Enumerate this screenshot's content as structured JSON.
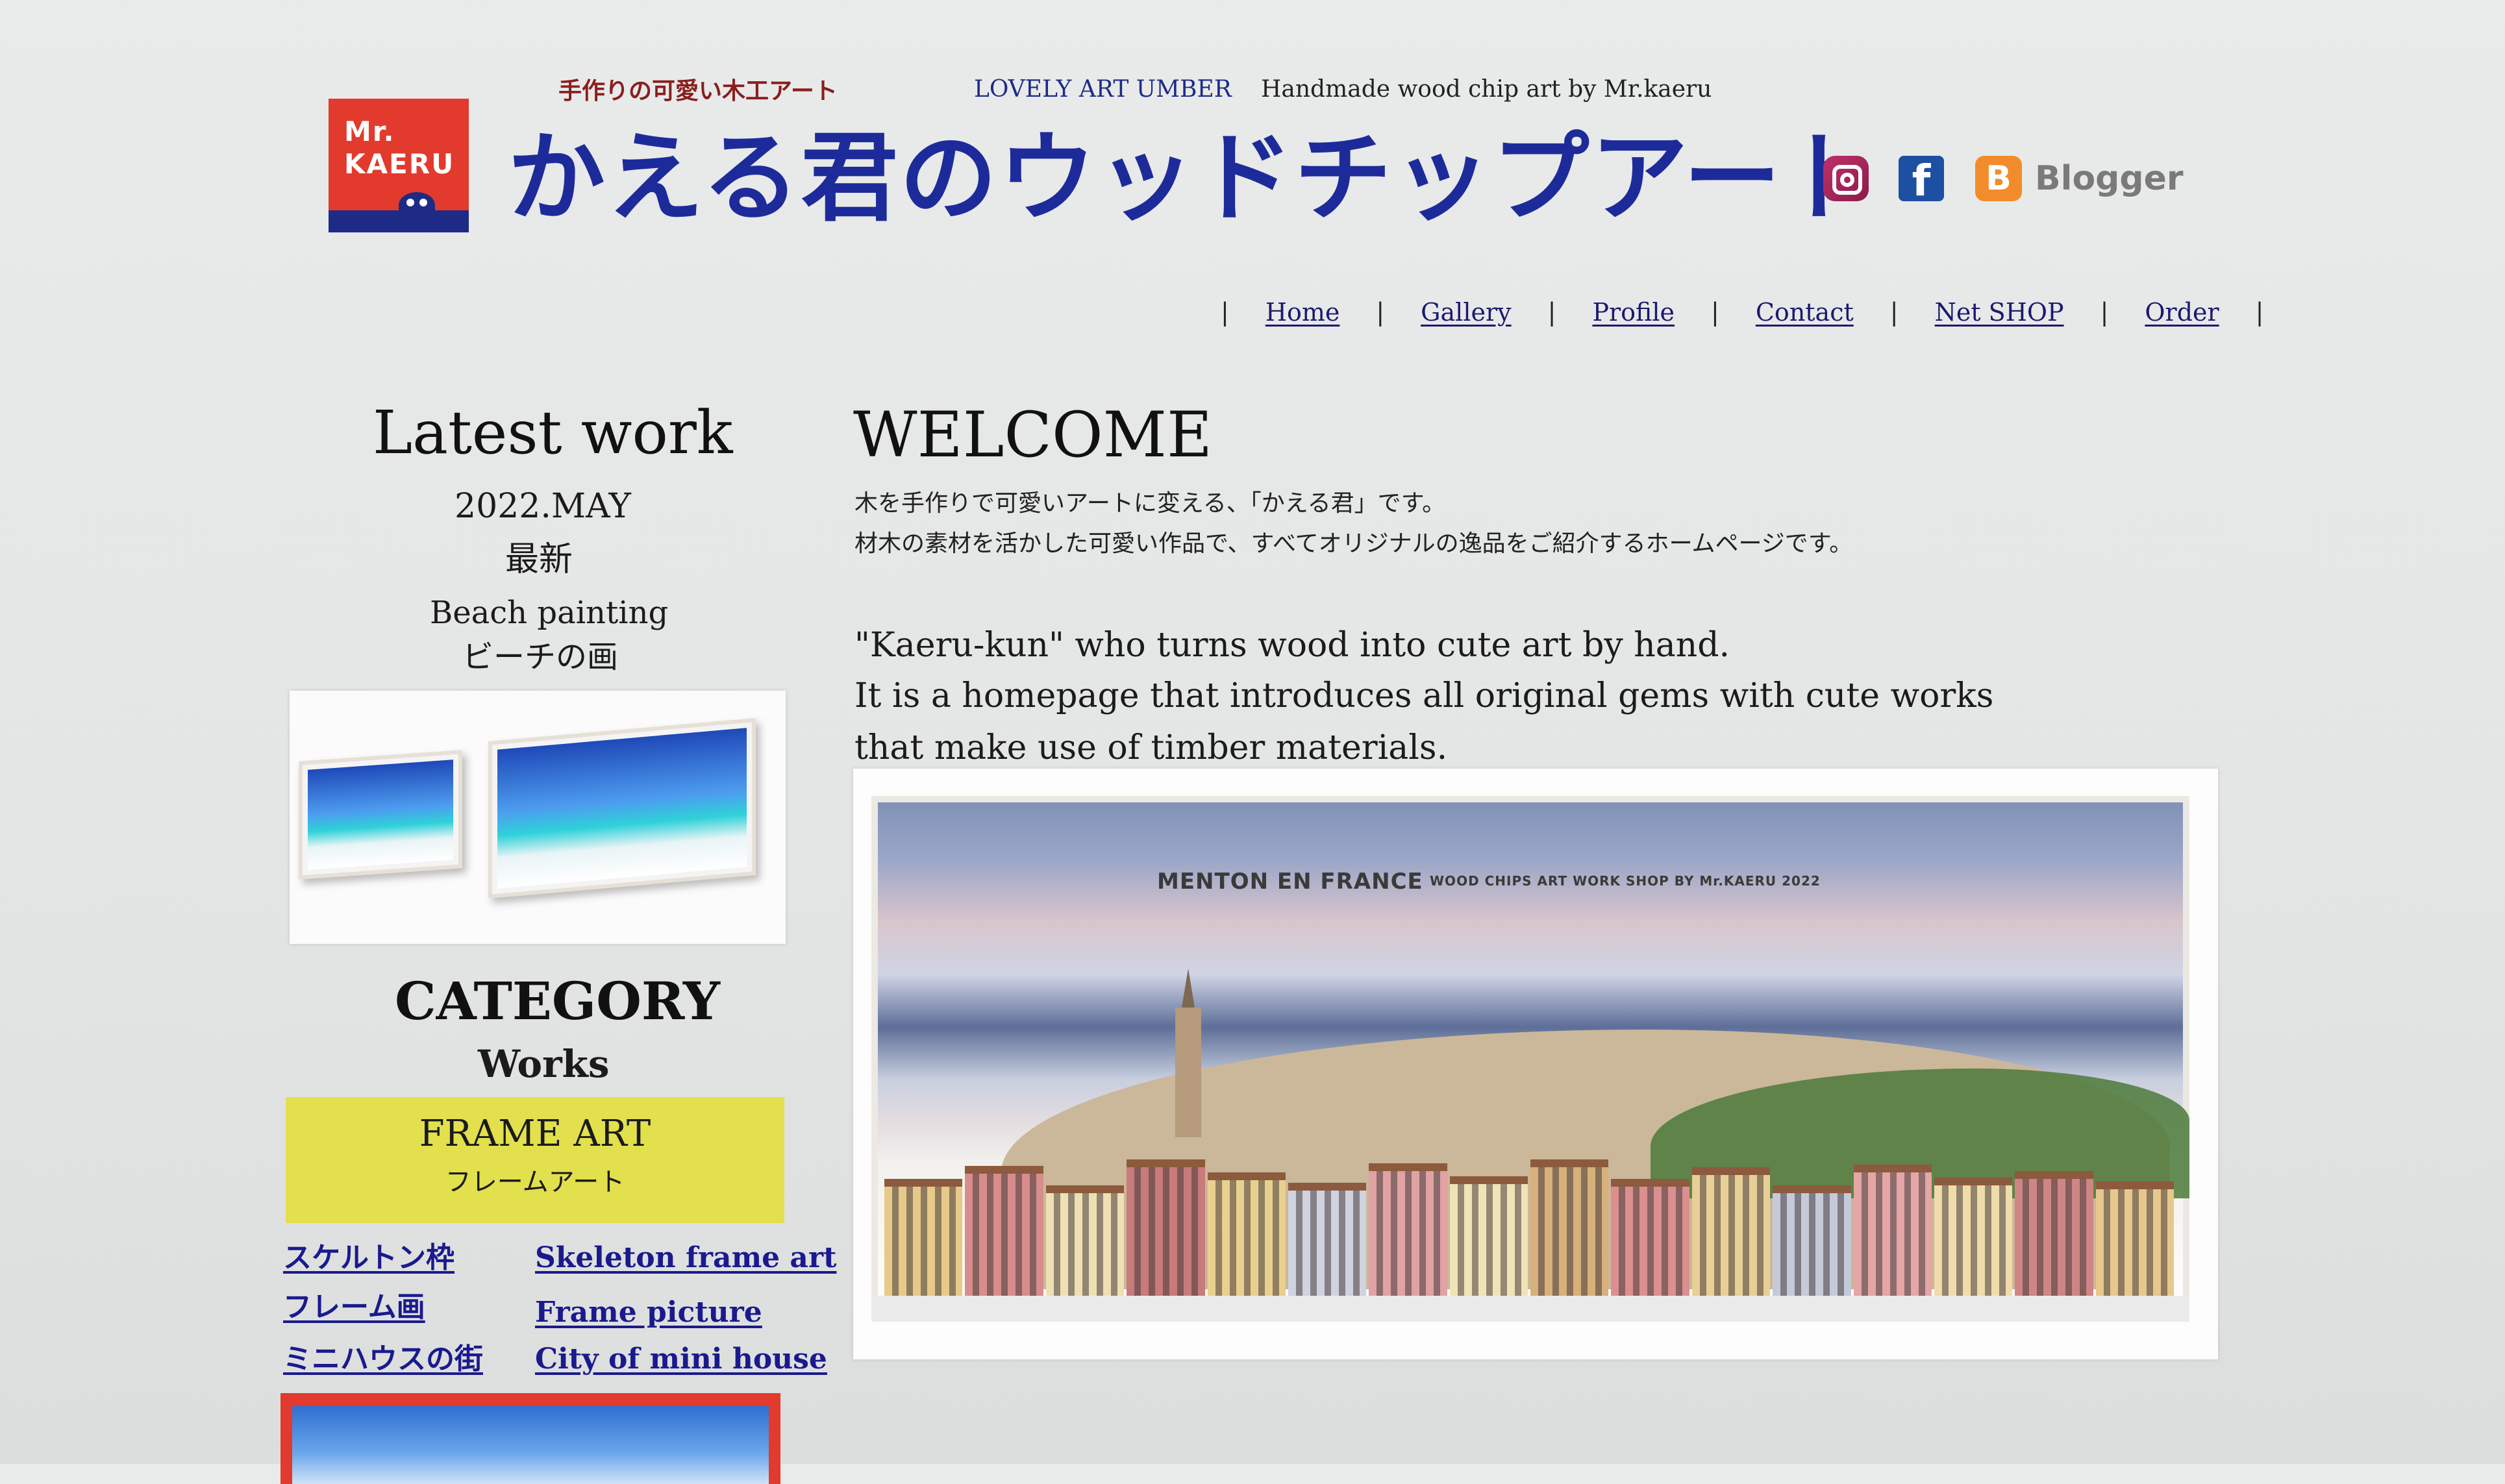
{
  "header": {
    "logo_text": "Mr.\nKAERU",
    "tagline_jp": "手作りの可愛い木工アート",
    "tagline_en_brand": "LOVELY ART UMBER",
    "tagline_en_desc": "Handmade wood chip art by Mr.kaeru",
    "site_title": "かえる君のウッドチップアート",
    "social": {
      "facebook_glyph": "f",
      "blogger_glyph": "B",
      "blogger_label": "Blogger"
    }
  },
  "nav": {
    "separator": "|",
    "items": [
      {
        "label": "Home"
      },
      {
        "label": "Gallery"
      },
      {
        "label": "Profile"
      },
      {
        "label": "Contact"
      },
      {
        "label": "Net SHOP"
      },
      {
        "label": "Order"
      }
    ]
  },
  "sidebar": {
    "latest_title": "Latest work",
    "latest_date": "2022.MAY",
    "latest_badge": "最新",
    "latest_name_en": "Beach painting",
    "latest_name_jp": "ビーチの画",
    "category_title": "CATEGORY",
    "category_sub": "Works",
    "frame_art_en": "FRAME ART",
    "frame_art_jp": "フレームアート",
    "links": [
      {
        "jp": "スケルトン枠",
        "en": "Skeleton frame art"
      },
      {
        "jp": "フレーム画",
        "en": "Frame picture"
      },
      {
        "jp": "ミニハウスの街",
        "en": "City of mini house"
      }
    ]
  },
  "main": {
    "welcome": "WELCOME",
    "jp_lines": [
      "木を手作りで可愛いアートに変える、「かえる君」です。",
      "材木の素材を活かした可愛い作品で、すべてオリジナルの逸品をご紹介するホームページです。"
    ],
    "en_lines": [
      "\"Kaeru-kun\" who turns wood into cute art by hand.",
      "It is a homepage that introduces all original gems with cute works",
      "that make use of timber materials."
    ],
    "painting_title": "MENTON EN FRANCE",
    "painting_sub": "WOOD CHIPS ART WORK SHOP BY Mr.KAERU 2022"
  },
  "colors": {
    "title_blue": "#1d2b9a",
    "logo_red": "#e23a2c",
    "link_blue": "#1a1a8e",
    "frame_art_yellow": "#e2e04d"
  }
}
